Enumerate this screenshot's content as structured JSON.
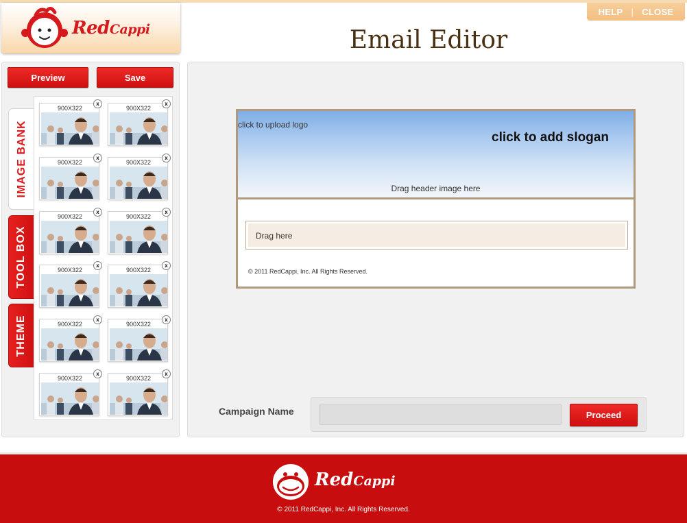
{
  "header": {
    "brand_main": "Red",
    "brand_small": "Cappi",
    "help_label": "HELP",
    "separator": "|",
    "close_label": "CLOSE",
    "page_title": "Email Editor"
  },
  "toolbar": {
    "preview_label": "Preview",
    "save_label": "Save"
  },
  "side_tabs": [
    {
      "label": "IMAGE BANK",
      "active": true
    },
    {
      "label": "TOOL BOX",
      "active": false
    },
    {
      "label": "THEME",
      "active": false
    }
  ],
  "image_bank": {
    "thumbs": [
      {
        "label": "900X322",
        "remove": "x"
      },
      {
        "label": "900X322",
        "remove": "x"
      },
      {
        "label": "900X322",
        "remove": "x"
      },
      {
        "label": "900X322",
        "remove": "x"
      },
      {
        "label": "900X322",
        "remove": "x"
      },
      {
        "label": "900X322",
        "remove": "x"
      },
      {
        "label": "900X322",
        "remove": "x"
      },
      {
        "label": "900X322",
        "remove": "x"
      },
      {
        "label": "900X322",
        "remove": "x"
      },
      {
        "label": "900X322",
        "remove": "x"
      },
      {
        "label": "900X322",
        "remove": "x"
      },
      {
        "label": "900X322",
        "remove": "x"
      }
    ]
  },
  "email": {
    "upload_logo": "click to upload logo",
    "slogan": "click to add slogan",
    "drag_header": "Drag header image here",
    "drag_here": "Drag here",
    "copyright": "© 2011 RedCappi, Inc. All Rights Reserved."
  },
  "campaign": {
    "label": "Campaign Name",
    "value": "",
    "proceed_label": "Proceed"
  },
  "footer": {
    "brand_main": "Red",
    "brand_small": "Cappi",
    "copyright": "© 2011 RedCappi, Inc. All Rights Reserved."
  },
  "colors": {
    "brand_red": "#d6191c",
    "footer_red": "#c80d0f",
    "title_brown": "#4a3013",
    "email_border": "#b09a7b"
  }
}
